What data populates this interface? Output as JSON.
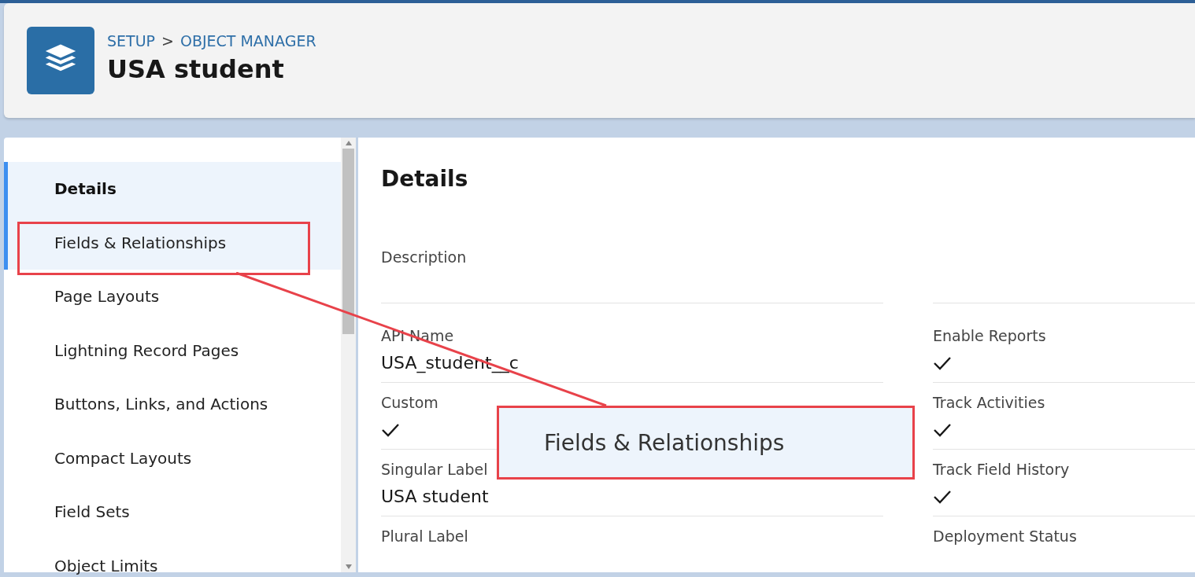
{
  "header": {
    "breadcrumb": [
      {
        "label": "SETUP"
      },
      {
        "label": "OBJECT MANAGER"
      }
    ],
    "separator": ">",
    "title": "USA student"
  },
  "sidebar": {
    "items": [
      {
        "label": "Details",
        "selected": true,
        "hovered": false,
        "framed": false
      },
      {
        "label": "Fields & Relationships",
        "selected": false,
        "hovered": true,
        "framed": true
      },
      {
        "label": "Page Layouts",
        "selected": false,
        "hovered": false,
        "framed": false
      },
      {
        "label": "Lightning Record Pages",
        "selected": false,
        "hovered": false,
        "framed": false
      },
      {
        "label": "Buttons, Links, and Actions",
        "selected": false,
        "hovered": false,
        "framed": false
      },
      {
        "label": "Compact Layouts",
        "selected": false,
        "hovered": false,
        "framed": false
      },
      {
        "label": "Field Sets",
        "selected": false,
        "hovered": false,
        "framed": false
      },
      {
        "label": "Object Limits",
        "selected": false,
        "hovered": false,
        "framed": false
      }
    ]
  },
  "details": {
    "heading": "Details",
    "rows": [
      {
        "left": {
          "kind": "text",
          "label": "Description"
        }
      },
      {
        "left": {
          "kind": "text",
          "label": "API Name",
          "value": "USA_student__c"
        },
        "right": {
          "kind": "checkbox",
          "label": "Enable Reports",
          "checked": true
        }
      },
      {
        "left": {
          "kind": "checkbox",
          "label": "Custom",
          "checked": true
        },
        "right": {
          "kind": "checkbox",
          "label": "Track Activities",
          "checked": true
        }
      },
      {
        "left": {
          "kind": "text",
          "label": "Singular Label",
          "value": "USA student"
        },
        "right": {
          "kind": "checkbox",
          "label": "Track Field History",
          "checked": true
        }
      },
      {
        "left": {
          "kind": "text",
          "label": "Plural Label"
        },
        "right": {
          "kind": "text",
          "label": "Deployment Status"
        }
      }
    ]
  },
  "callout": {
    "text": "Fields & Relationships"
  }
}
